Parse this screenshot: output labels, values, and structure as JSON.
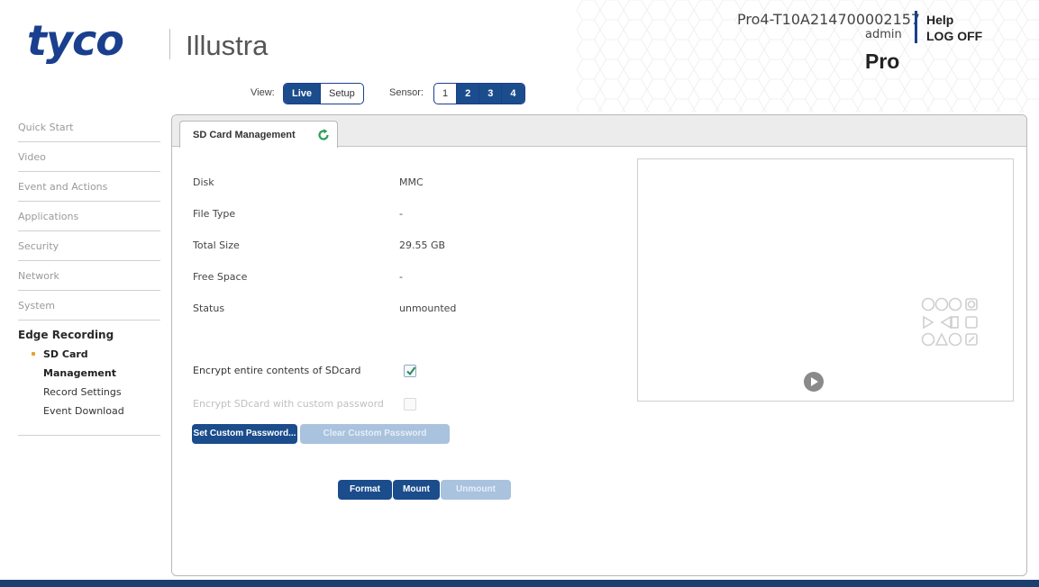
{
  "brand": {
    "logo": "tyco",
    "product": "Illustra"
  },
  "header": {
    "device_name": "Pro4-T10A214700002157",
    "user": "admin",
    "help": "Help",
    "logoff": "LOG OFF",
    "model": "Pro",
    "view_label": "View:",
    "view_options": [
      "Live",
      "Setup"
    ],
    "view_selected": "Live",
    "sensor_label": "Sensor:",
    "sensor_options": [
      "1",
      "2",
      "3",
      "4"
    ],
    "sensor_selected": [
      "2",
      "3",
      "4"
    ]
  },
  "sidebar": {
    "items": [
      "Quick Start",
      "Video",
      "Event and Actions",
      "Applications",
      "Security",
      "Network",
      "System"
    ],
    "active_group": "Edge Recording",
    "sub_items": [
      "SD Card Management",
      "Record Settings",
      "Event Download"
    ],
    "active_sub": "SD Card Management"
  },
  "main": {
    "tab": "SD Card Management",
    "info": [
      {
        "label": "Disk",
        "value": "MMC"
      },
      {
        "label": "File Type",
        "value": "-"
      },
      {
        "label": "Total Size",
        "value": "29.55 GB"
      },
      {
        "label": "Free Space",
        "value": "-"
      },
      {
        "label": "Status",
        "value": "unmounted"
      }
    ],
    "encrypt_all": {
      "label": "Encrypt entire contents of SDcard",
      "checked": true
    },
    "encrypt_custom": {
      "label": "Encrypt SDcard with custom password",
      "checked": false,
      "disabled": true
    },
    "buttons": {
      "set_password": "Set Custom Password...",
      "clear_password": "Clear Custom Password",
      "format": "Format",
      "mount": "Mount",
      "unmount": "Unmount"
    }
  },
  "colors": {
    "brand_blue": "#1b3f8f",
    "button_blue": "#1b4c8c",
    "accent_orange": "#e5a22a",
    "check_green": "#2e8b57"
  }
}
